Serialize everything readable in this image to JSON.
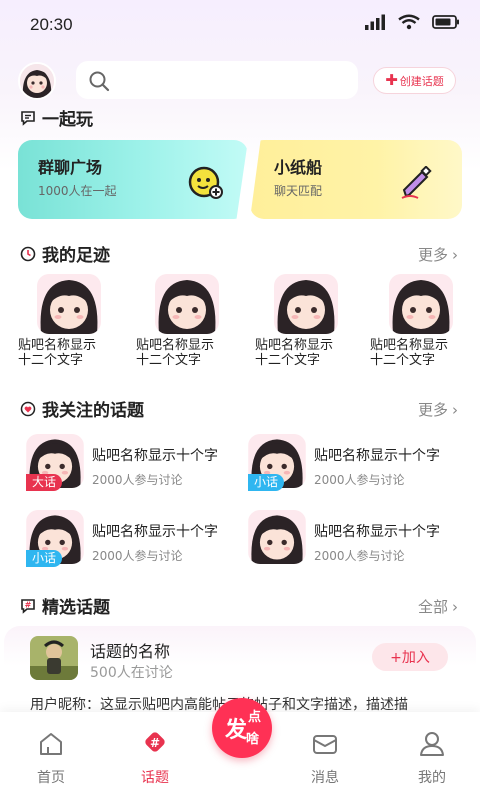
{
  "status": {
    "time": "20:30"
  },
  "header": {
    "create_label": "创建话题"
  },
  "play": {
    "title": "一起玩",
    "cards": [
      {
        "title": "群聊广场",
        "sub": "1000人在一起"
      },
      {
        "title": "小纸船",
        "sub": "聊天匹配"
      }
    ]
  },
  "footprints": {
    "title": "我的足迹",
    "more": "更多",
    "items": [
      {
        "line1": "贴吧名称显示",
        "line2": "十二个文字"
      },
      {
        "line1": "贴吧名称显示",
        "line2": "十二个文字"
      },
      {
        "line1": "贴吧名称显示",
        "line2": "十二个文字"
      },
      {
        "line1": "贴吧名称显示",
        "line2": "十二个文字"
      }
    ]
  },
  "followed": {
    "title": "我关注的话题",
    "more": "更多",
    "items": [
      {
        "tag": "大话",
        "tag_color": "#e8334f",
        "name": "贴吧名称显示十个字",
        "count": "2000人参与讨论"
      },
      {
        "tag": "小话",
        "tag_color": "#2fb6f0",
        "name": "贴吧名称显示十个字",
        "count": "2000人参与讨论"
      },
      {
        "tag": "小话",
        "tag_color": "#2fb6f0",
        "name": "贴吧名称显示十个字",
        "count": "2000人参与讨论"
      },
      {
        "tag": "",
        "tag_color": "",
        "name": "贴吧名称显示十个字",
        "count": "2000人参与讨论"
      }
    ]
  },
  "selected": {
    "title": "精选话题",
    "more": "全部",
    "topic_name": "话题的名称",
    "count": "500人在讨论",
    "join_label": "+加入",
    "desc": "用户昵称：这显示贴吧内高能帖子的帖子和文字描述，描述描"
  },
  "tabbar": {
    "tabs": [
      {
        "label": "首页",
        "icon": "home-icon"
      },
      {
        "label": "话题",
        "icon": "topic-icon"
      },
      {
        "label": "消息",
        "icon": "message-icon"
      },
      {
        "label": "我的",
        "icon": "profile-icon"
      }
    ],
    "fab": {
      "main": "发",
      "sup": "点",
      "sub": "啥"
    }
  },
  "colors": {
    "accent": "#e8334f",
    "teal_card": "#79e2d6",
    "yellow_card": "#fff3a7",
    "blue_tag": "#2fb6f0"
  }
}
